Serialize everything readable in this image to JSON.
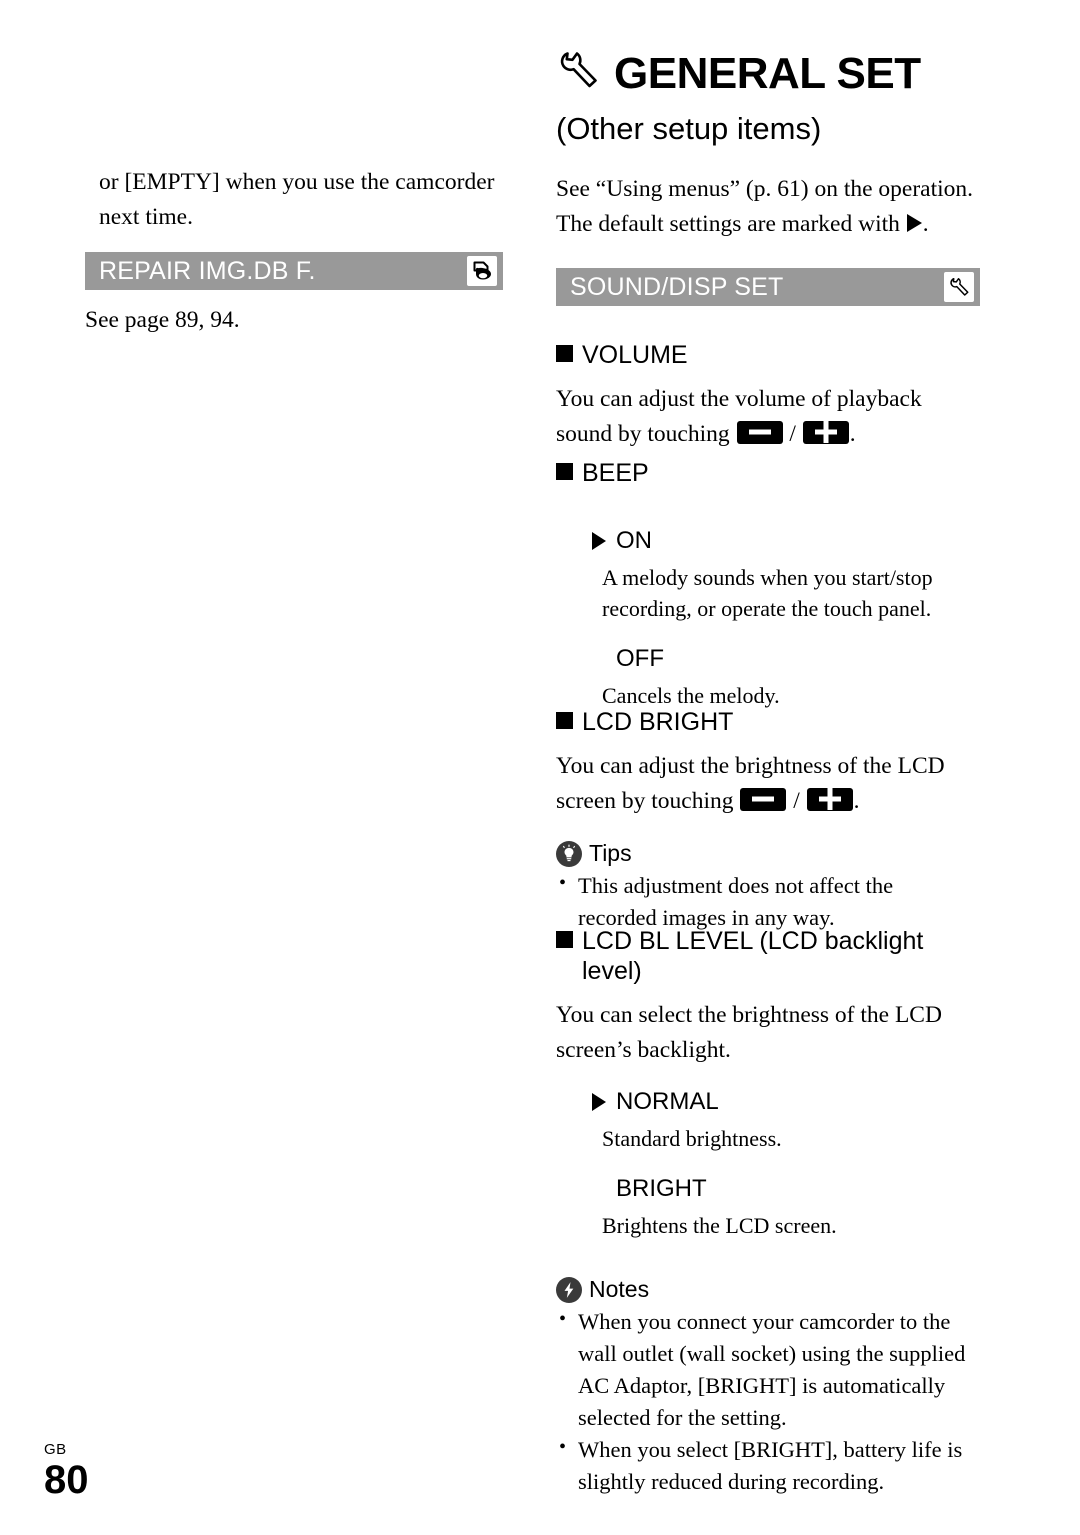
{
  "chapter": {
    "icon": "wrench-icon",
    "title": "GENERAL SET",
    "subtitle": "(Other setup items)"
  },
  "intro": {
    "line1": "See “Using menus” (p. 61) on the operation.",
    "line2_before": "The default settings are marked with",
    "line2_after": "."
  },
  "left_column": {
    "continued_text": "or [EMPTY] when you use the camcorder next time.",
    "section_bar": {
      "label": "REPAIR IMG.DB F.",
      "icon": "manage-media-icon"
    },
    "see_page": "See page 89, 94."
  },
  "right_column": {
    "section_bar": {
      "label": "SOUND/DISP SET",
      "icon": "wrench-icon"
    },
    "items": [
      {
        "heading": "VOLUME",
        "desc_before": "You can adjust the volume of playback sound by touching",
        "desc_mid": "/",
        "desc_after": ".",
        "button_minus": "minus-button-icon",
        "button_plus": "plus-button-icon"
      },
      {
        "heading": "BEEP",
        "options": [
          {
            "label": "ON",
            "is_default": true,
            "desc": "A melody sounds when you start/stop recording, or operate the touch panel."
          },
          {
            "label": "OFF",
            "is_default": false,
            "desc": "Cancels the melody."
          }
        ]
      },
      {
        "heading": "LCD BRIGHT",
        "desc_before": "You can adjust the brightness of the LCD screen by touching",
        "desc_mid": "/",
        "desc_after": ".",
        "button_minus": "minus-button-icon",
        "button_plus": "plus-button-icon",
        "tips": {
          "icon": "lightbulb-icon",
          "label": "Tips",
          "bullets": [
            "This adjustment does not affect the recorded images in any way."
          ]
        }
      },
      {
        "heading": "LCD BL LEVEL (LCD backlight level)",
        "desc": "You can select the brightness of the LCD screen’s backlight.",
        "options": [
          {
            "label": "NORMAL",
            "is_default": true,
            "desc": "Standard brightness."
          },
          {
            "label": "BRIGHT",
            "is_default": false,
            "desc": "Brightens the LCD screen."
          }
        ],
        "notes": {
          "icon": "lightning-bolt-icon",
          "label": "Notes",
          "bullets": [
            "When you connect your camcorder to the wall outlet (wall socket) using the supplied AC Adaptor, [BRIGHT] is automatically selected for the setting.",
            "When you select [BRIGHT], battery life is slightly reduced during recording."
          ]
        }
      }
    ]
  },
  "footer": {
    "region": "GB",
    "page_number": "80"
  },
  "colors": {
    "section_bar_gray": "#999999",
    "callout_icon_gray": "#3a3a3a"
  }
}
